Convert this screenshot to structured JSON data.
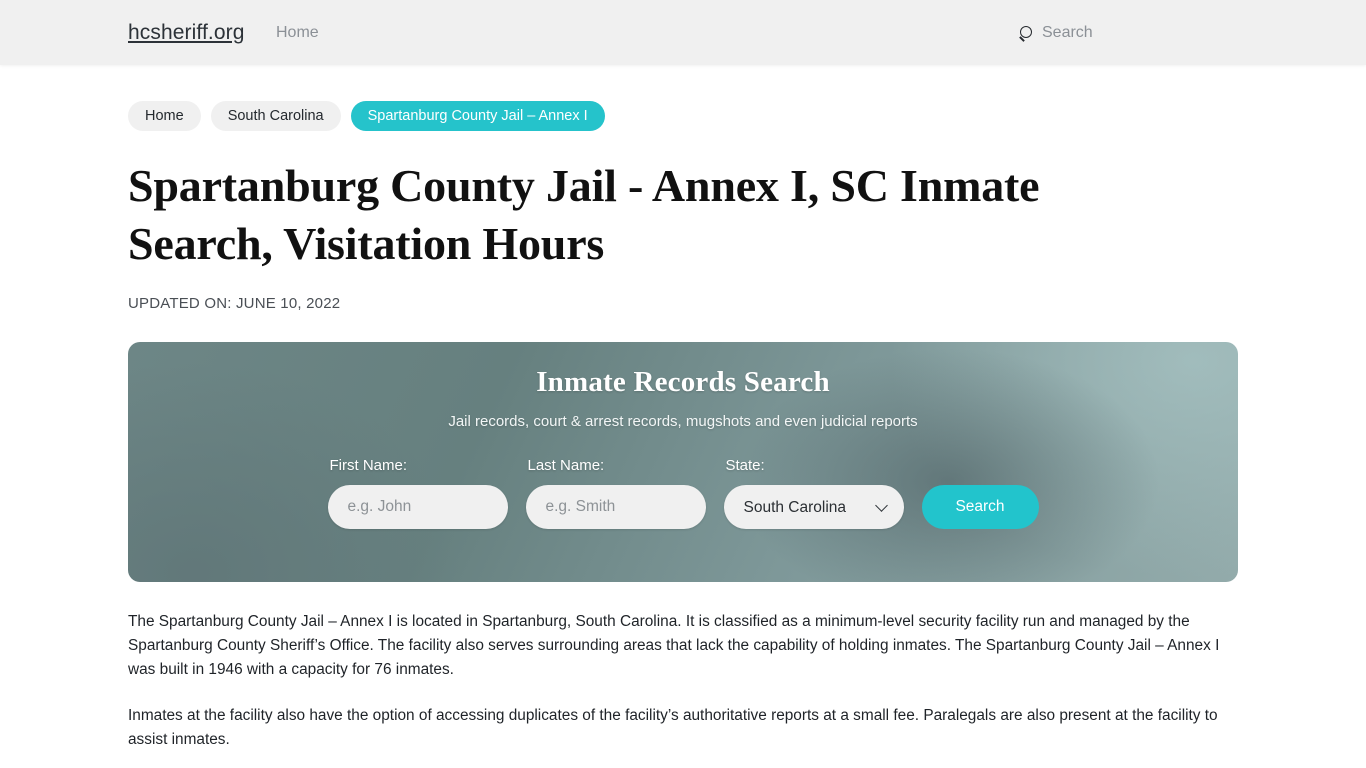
{
  "header": {
    "brand": "hcsheriff.org",
    "nav": [
      {
        "label": "Home"
      }
    ],
    "search_label": "Search",
    "search_icon": "search-icon"
  },
  "breadcrumb": [
    {
      "label": "Home",
      "active": false
    },
    {
      "label": "South Carolina",
      "active": false
    },
    {
      "label": "Spartanburg County Jail – Annex I",
      "active": true
    }
  ],
  "article": {
    "title": "Spartanburg County Jail - Annex I, SC Inmate Search, Visitation Hours",
    "updated_on": "UPDATED ON: JUNE 10, 2022",
    "paragraphs": [
      "The Spartanburg County Jail – Annex I is located in Spartanburg, South Carolina. It is classified as a minimum-level security facility run and managed by the Spartanburg County Sheriff’s Office. The facility also serves surrounding areas that lack the capability of holding inmates. The Spartanburg County Jail – Annex I was built in 1946 with a capacity for 76 inmates.",
      "Inmates at the facility also have the option of accessing duplicates of the facility’s authoritative reports at a small fee. Paralegals are also present at the facility to assist inmates."
    ]
  },
  "search_panel": {
    "title": "Inmate Records Search",
    "subtitle": "Jail records, court & arrest records, mugshots and even judicial reports",
    "first_name": {
      "label": "First Name:",
      "placeholder": "e.g. John",
      "value": ""
    },
    "last_name": {
      "label": "Last Name:",
      "placeholder": "e.g. Smith",
      "value": ""
    },
    "state": {
      "label": "State:",
      "selected": "South Carolina"
    },
    "submit_label": "Search"
  },
  "colors": {
    "accent_teal": "#22c4cc",
    "crumb_active": "#25c3cb",
    "header_bg": "#f0f0f0",
    "panel_base": "#66807f",
    "input_bg": "#f0f0f0"
  }
}
